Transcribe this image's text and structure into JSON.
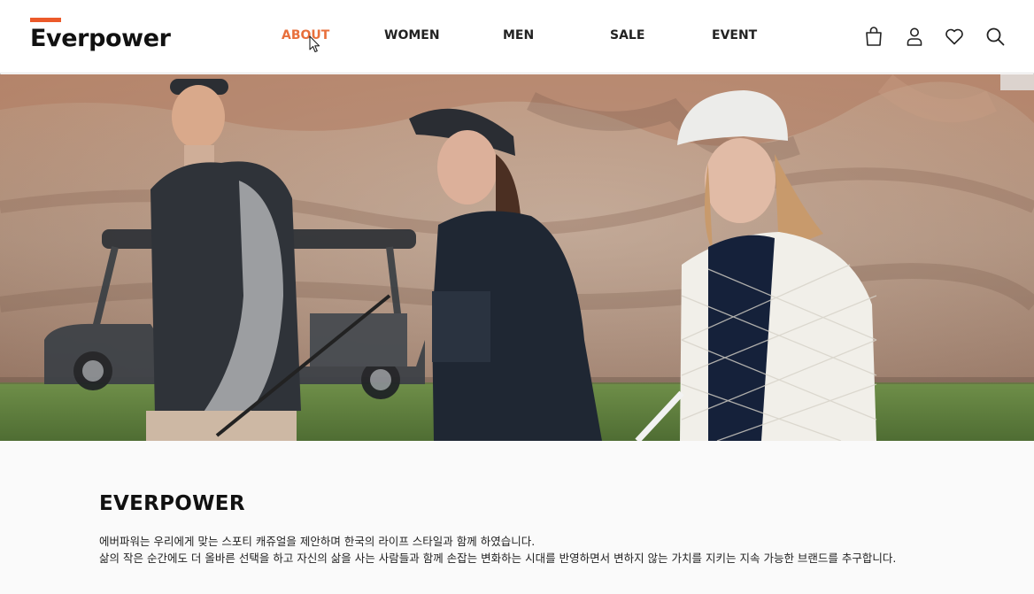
{
  "brand": {
    "logo_text": "Everpower",
    "accent_color": "#ec5a2a"
  },
  "nav": {
    "items": [
      {
        "label": "ABOUT",
        "active": true
      },
      {
        "label": "WOMEN",
        "active": false
      },
      {
        "label": "MEN",
        "active": false
      },
      {
        "label": "SALE",
        "active": false
      },
      {
        "label": "EVENT",
        "active": false
      }
    ],
    "active_color": "#e8703c"
  },
  "header_icons": [
    "shopping-bag-icon",
    "user-icon",
    "heart-icon",
    "search-icon"
  ],
  "hero": {
    "image": "golf-lifestyle-photo"
  },
  "about": {
    "title": "EVERPOWER",
    "lines": [
      "에버파워는 우리에게 맞는 스포티 캐쥬얼을 제안하며 한국의 라이프 스타일과 함께 하였습니다.",
      "삶의 작은 순간에도 더 올바른 선택을 하고 자신의 삶을 사는 사람들과 함께 손잡는 변화하는 시대를 반영하면서 변하지 않는 가치를 지키는 지속 가능한 브랜드를 추구합니다."
    ]
  }
}
